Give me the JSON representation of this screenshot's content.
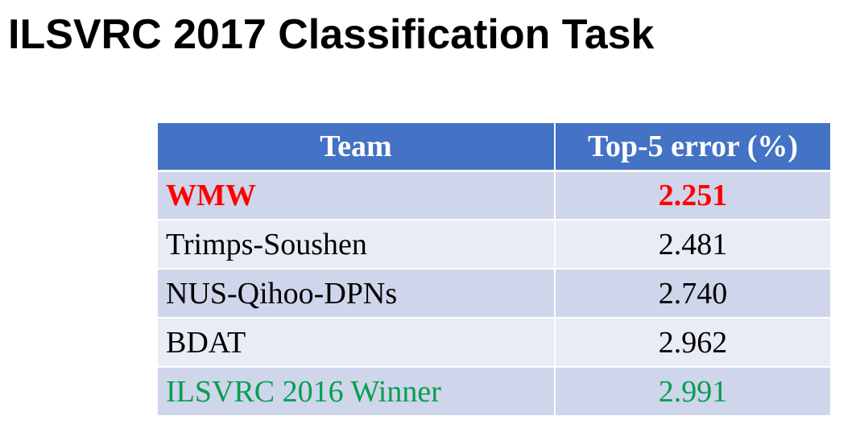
{
  "title": "ILSVRC 2017 Classification Task",
  "table": {
    "headers": {
      "team": "Team",
      "error": "Top-5 error (%)"
    },
    "rows": [
      {
        "team": "WMW",
        "error": "2.251"
      },
      {
        "team": "Trimps-Soushen",
        "error": "2.481"
      },
      {
        "team": "NUS-Qihoo-DPNs",
        "error": "2.740"
      },
      {
        "team": "BDAT",
        "error": "2.962"
      },
      {
        "team": "ILSVRC 2016 Winner",
        "error": "2.991"
      }
    ]
  },
  "colors": {
    "header_bg": "#4472c4",
    "row_odd_bg": "#cfd5ea",
    "row_even_bg": "#e9ebf5",
    "highlight_text": "#ff0000",
    "baseline_text": "#00a050"
  }
}
